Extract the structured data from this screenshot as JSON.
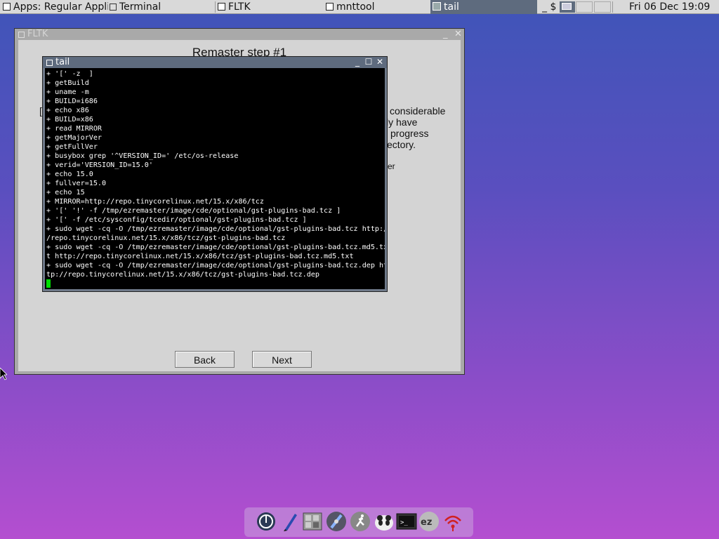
{
  "taskbar": {
    "apps_label": "Apps: Regular Applic",
    "items": [
      {
        "label": "Terminal"
      },
      {
        "label": "FLTK"
      },
      {
        "label": "mnttool"
      },
      {
        "label": "tail"
      }
    ],
    "prompt_text": "_ $",
    "clock": "Fri 06 Dec 19:09"
  },
  "fltk_window": {
    "title": "FLTK",
    "heading": "Remaster step #1",
    "text_fragments": [
      "considerable",
      "ly have",
      "progress",
      "ectory.",
      "er"
    ],
    "left_fragment": "[",
    "back_label": "Back",
    "next_label": "Next"
  },
  "tail_window": {
    "title": "tail",
    "lines": [
      "+ '[' -z  ]",
      "+ getBuild",
      "+ uname -m",
      "+ BUILD=i686",
      "+ echo x86",
      "+ BUILD=x86",
      "+ read MIRROR",
      "+ getMajorVer",
      "+ getFullVer",
      "+ busybox grep '^VERSION_ID=' /etc/os-release",
      "+ verid='VERSION_ID=15.0'",
      "+ echo 15.0",
      "+ fullver=15.0",
      "+ echo 15",
      "+ MIRROR=http://repo.tinycorelinux.net/15.x/x86/tcz",
      "+ '[' '!' -f /tmp/ezremaster/image/cde/optional/gst-plugins-bad.tcz ]",
      "+ '[' -f /etc/sysconfig/tcedir/optional/gst-plugins-bad.tcz ]",
      "+ sudo wget -cq -O /tmp/ezremaster/image/cde/optional/gst-plugins-bad.tcz http:/",
      "/repo.tinycorelinux.net/15.x/x86/tcz/gst-plugins-bad.tcz",
      "+ sudo wget -cq -O /tmp/ezremaster/image/cde/optional/gst-plugins-bad.tcz.md5.tx",
      "t http://repo.tinycorelinux.net/15.x/x86/tcz/gst-plugins-bad.tcz.md5.txt",
      "+ sudo wget -cq -O /tmp/ezremaster/image/cde/optional/gst-plugins-bad.tcz.dep ht",
      "tp://repo.tinycorelinux.net/15.x/x86/tcz/gst-plugins-bad.tcz.dep"
    ]
  },
  "dock": {
    "icons": [
      "power-icon",
      "pen-icon",
      "apps-grid-icon",
      "disk-icon",
      "runner-icon",
      "panda-icon",
      "terminal-icon",
      "ez-icon",
      "wifi-icon"
    ]
  },
  "colors": {
    "taskbar_bg": "#d9d9d9",
    "active_task_bg": "#5e6b7e",
    "terminal_bg": "#000000",
    "cursor": "#00e000"
  }
}
